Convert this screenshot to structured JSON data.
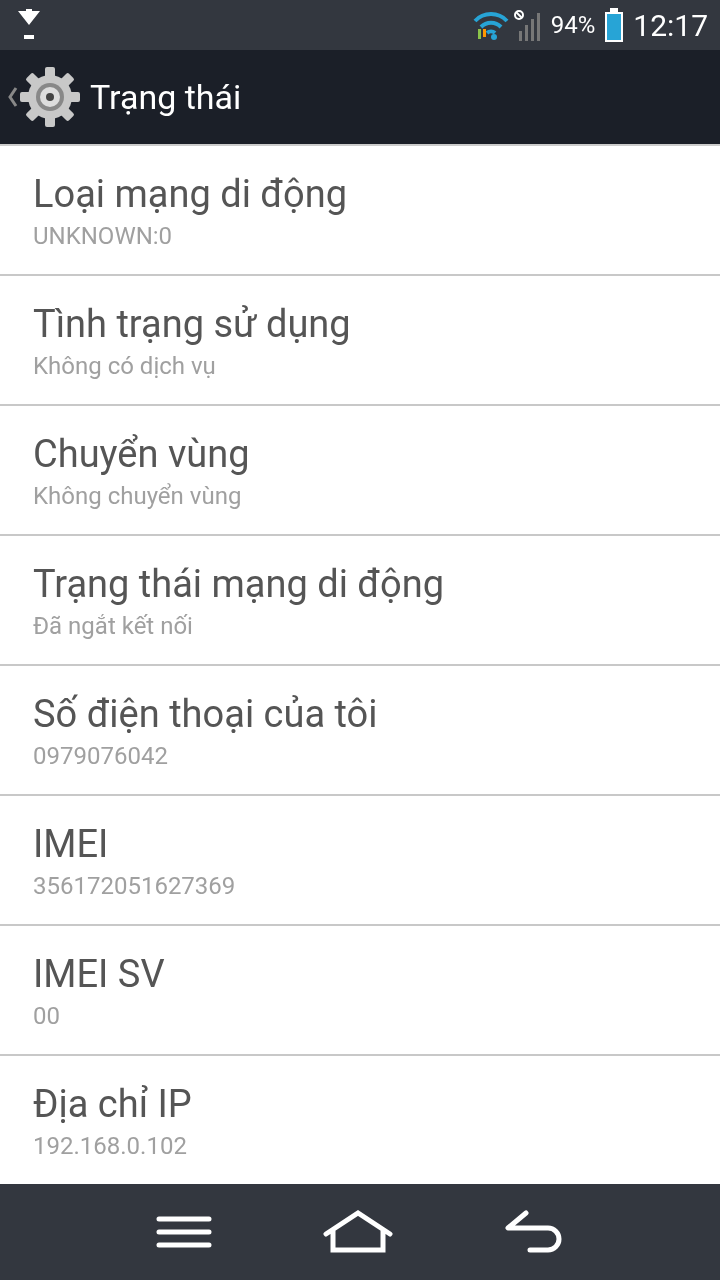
{
  "status_bar": {
    "battery": "94%",
    "time": "12:17"
  },
  "action_bar": {
    "title": "Trạng thái"
  },
  "items": [
    {
      "title": "Loại mạng di động",
      "value": "UNKNOWN:0"
    },
    {
      "title": "Tình trạng sử dụng",
      "value": "Không có dịch vụ"
    },
    {
      "title": "Chuyển vùng",
      "value": "Không chuyển vùng"
    },
    {
      "title": "Trạng thái mạng di động",
      "value": "Đã ngắt kết nối"
    },
    {
      "title": "Số điện thoại của tôi",
      "value": "0979076042"
    },
    {
      "title": "IMEI",
      "value": "356172051627369"
    },
    {
      "title": "IMEI SV",
      "value": "00"
    },
    {
      "title": "Địa chỉ IP",
      "value": "192.168.0.102"
    }
  ]
}
